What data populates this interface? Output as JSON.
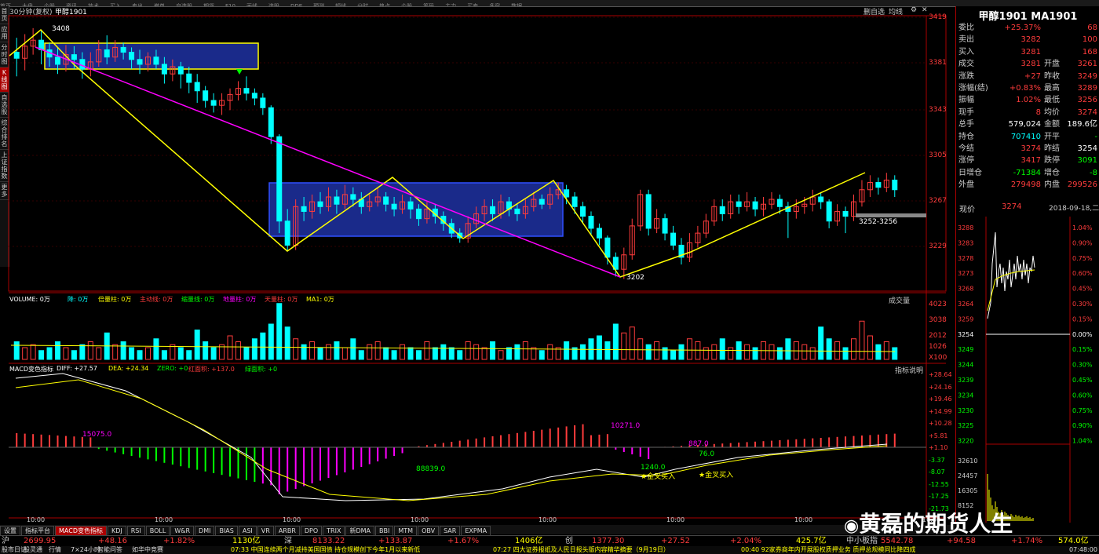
{
  "toolbar": {
    "items": [
      "首页",
      "大盘",
      "个股",
      "资讯",
      "技术",
      "买入",
      "卖出",
      "撤单",
      "自选股",
      "期货",
      "F10",
      "画线",
      "选股",
      "DDE",
      "预测",
      "短线",
      "分时",
      "热点",
      "个股",
      "筹码",
      "主力",
      "买卖",
      "多窗",
      "数据"
    ]
  },
  "left_nav": [
    "首页",
    "应用",
    "分时图",
    "K线图",
    "自选股",
    "综合排名",
    "上证指数",
    "更多"
  ],
  "left_nav_active": 3,
  "chart_header": {
    "period": "30分钟(复权)",
    "symbol": "甲醇1901",
    "buttons": [
      "删自选",
      "均线"
    ]
  },
  "price_axis": [
    "3419",
    "3381",
    "3343",
    "3305",
    "3267",
    "3229"
  ],
  "annotations": {
    "high": "3408",
    "low": "3202",
    "range": "3252-3256"
  },
  "volume_header": {
    "labels": [
      "VOLUME: 0万",
      "降: 0万",
      "倍量柱: 0万",
      "主动线: 0万",
      "缩量线: 0万",
      "地量柱: 0万",
      "天量柱: 0万",
      "MA1: 0万"
    ],
    "button": "成交量"
  },
  "volume_axis": [
    "4023",
    "3038",
    "2012",
    "1026",
    "X100"
  ],
  "macd_header": {
    "title": "MACD变色指标",
    "diff": "DIFF: +27.57",
    "dea": "DEA: +24.34",
    "zero": "ZERO: +0",
    "red": "红面积: +137.0",
    "green": "绿面积: +0",
    "button": "指标说明"
  },
  "macd_axis": [
    "+28.64",
    "+24.16",
    "+19.46",
    "+14.99",
    "+10.28",
    "+5.81",
    "+1.10",
    "-3.37",
    "-8.07",
    "-12.55",
    "-17.25",
    "-21.73"
  ],
  "macd_labels": {
    "a": "15075.0",
    "b": "88839.0",
    "c": "10271.0",
    "d": "1240.0",
    "e": "887.0",
    "f": "76.0",
    "g1": "金叉买入",
    "g2": "金叉买入"
  },
  "time_axis": [
    "10:00",
    "10:00",
    "10:00",
    "10:00",
    "10:00",
    "10:00",
    "10:00",
    "10:00"
  ],
  "right_panel": {
    "title": "甲醇1901 MA1901",
    "rows": [
      {
        "l": "委比",
        "v": "+25.37%",
        "v2": "",
        "l2": "",
        "x": "68"
      },
      {
        "l": "卖出",
        "v": "3282",
        "v2": "",
        "l2": "",
        "x": "100"
      },
      {
        "l": "买入",
        "v": "3281",
        "v2": "",
        "l2": "",
        "x": "168"
      },
      {
        "l": "成交",
        "v": "3281",
        "l2": "开盘",
        "x": "3261"
      },
      {
        "l": "涨跌",
        "v": "+27",
        "l2": "昨收",
        "x": "3249"
      },
      {
        "l": "涨幅(结)",
        "v": "+0.83%",
        "l2": "最高",
        "x": "3289"
      },
      {
        "l": "振幅",
        "v": "1.02%",
        "l2": "最低",
        "x": "3256"
      },
      {
        "l": "现手",
        "v": "8",
        "l2": "均价",
        "x": "3274"
      },
      {
        "l": "总手",
        "v": "579,024",
        "l2": "金额",
        "x": "189.6亿"
      },
      {
        "l": "持仓",
        "v": "707410",
        "l2": "开平",
        "x": "-"
      },
      {
        "l": "今结",
        "v": "3274",
        "l2": "昨结",
        "x": "3254"
      },
      {
        "l": "涨停",
        "v": "3417",
        "l2": "跌停",
        "x": "3091"
      },
      {
        "l": "日增仓",
        "v": "-71384",
        "l2": "增仓",
        "x": "-8"
      },
      {
        "l": "外盘",
        "v": "279498",
        "l2": "内盘",
        "x": "299526"
      }
    ],
    "intraday": {
      "label": "现价",
      "price": "3274",
      "date": "2018-09-18,二",
      "left_axis": [
        "3288",
        "3283",
        "3278",
        "3273",
        "3268",
        "3264",
        "3259",
        "3254",
        "3249",
        "3244",
        "3239",
        "3234",
        "3230",
        "3225",
        "3220",
        "32610",
        "24457",
        "16305",
        "8152"
      ],
      "right_axis": [
        "1.04%",
        "0.90%",
        "0.75%",
        "0.60%",
        "0.45%",
        "0.30%",
        "0.15%",
        "0.00%",
        "0.15%",
        "0.30%",
        "0.45%",
        "0.60%",
        "0.75%",
        "0.90%",
        "1.04%"
      ]
    }
  },
  "bottom_tabs": [
    "设置",
    "指标平台",
    "MACD变色指标",
    "KDJ",
    "RSI",
    "BOLL",
    "W&R",
    "DMI",
    "BIAS",
    "ASI",
    "VR",
    "ARBR",
    "DPO",
    "TRIX",
    "新DMA",
    "BBI",
    "MTM",
    "OBV",
    "SAR",
    "EXPMA"
  ],
  "bottom_tab_selected": 2,
  "index_bar": {
    "sh": "沪",
    "sh_v": "2699.95",
    "sh_c": "+48.16",
    "sh_p": "+1.82%",
    "sh_a": "1130亿",
    "sz": "深",
    "sz_v": "8133.22",
    "sz_c": "+133.87",
    "sz_p": "+1.67%",
    "sz_a": "1406亿",
    "cy": "创",
    "cy_v": "1377.30",
    "cy_c": "+27.52",
    "cy_p": "+2.04%",
    "cy_a": "425.7亿",
    "zz": "中小板指",
    "zz_v": "5542.78",
    "zz_c": "+94.58",
    "zz_p": "+1.74%",
    "zz_a": "574.0亿"
  },
  "news_bar": [
    "股市日记",
    "股灵通",
    "行情",
    "7×24小时",
    "智能问答",
    "如华中竞赛",
    "07:33 中国连续两个月减持美国国债 持仓规模创下今年1月以来新低",
    "07:27 四大证券报纸及人民日报头版内容精华摘要（9月19日）",
    "00:40 92家券商年内开展股权质押业务 质押总规模同比降四成",
    "07:48:00"
  ],
  "watermark": "黄磊的期货人生",
  "colors": {
    "up": "#ff3c3c",
    "down": "#00ffff",
    "ma": "#ffff00",
    "box": "#1a2a8a",
    "trend": "#ff00ff"
  }
}
